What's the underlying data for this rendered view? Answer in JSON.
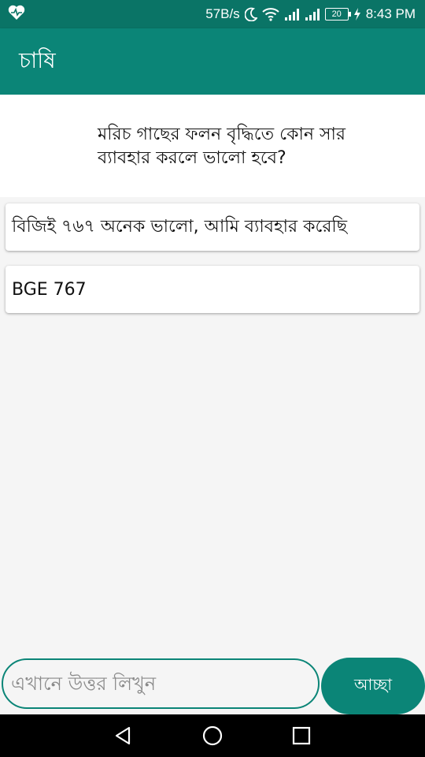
{
  "status_bar": {
    "network_speed": "57B/s",
    "battery_level": "20",
    "time": "8:43 PM",
    "icons": [
      "health-icon",
      "moon-icon",
      "wifi-icon",
      "signal-icon",
      "signal-icon",
      "battery-icon",
      "charging-icon"
    ]
  },
  "app_bar": {
    "title": "চাষি"
  },
  "question": {
    "text": "মরিচ গাছের ফলন বৃদ্ধিতে কোন সার ব্যাবহার করলে ভালো হবে?"
  },
  "answers": [
    {
      "text": "বিজিই ৭৬৭ অনেক ভালো, আমি ব্যাবহার করেছি"
    },
    {
      "text": "BGE 767"
    }
  ],
  "input": {
    "placeholder": "এখানে উত্তর লিখুন",
    "value": ""
  },
  "submit": {
    "label": "আচ্ছা"
  },
  "colors": {
    "primary": "#0b8577",
    "primary_dark": "#0a7466",
    "background": "#f5f5f5"
  }
}
